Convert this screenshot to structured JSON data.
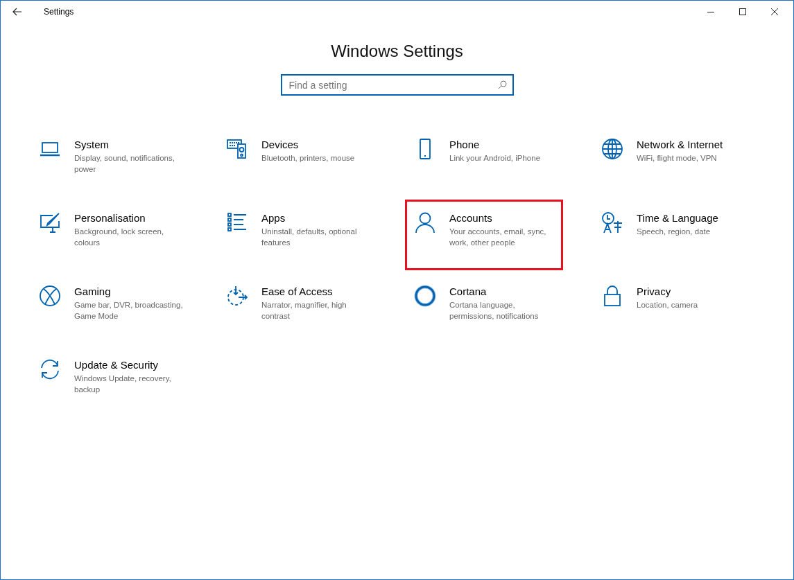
{
  "window": {
    "title": "Settings"
  },
  "heading": "Windows Settings",
  "search": {
    "placeholder": "Find a setting"
  },
  "items": [
    {
      "kind": "system",
      "title": "System",
      "subtitle": "Display, sound, notifications, power",
      "highlighted": false
    },
    {
      "kind": "devices",
      "title": "Devices",
      "subtitle": "Bluetooth, printers, mouse",
      "highlighted": false
    },
    {
      "kind": "phone",
      "title": "Phone",
      "subtitle": "Link your Android, iPhone",
      "highlighted": false
    },
    {
      "kind": "network",
      "title": "Network & Internet",
      "subtitle": "WiFi, flight mode, VPN",
      "highlighted": false
    },
    {
      "kind": "personalisation",
      "title": "Personalisation",
      "subtitle": "Background, lock screen, colours",
      "highlighted": false
    },
    {
      "kind": "apps",
      "title": "Apps",
      "subtitle": "Uninstall, defaults, optional features",
      "highlighted": false
    },
    {
      "kind": "accounts",
      "title": "Accounts",
      "subtitle": "Your accounts, email, sync, work, other people",
      "highlighted": true
    },
    {
      "kind": "time",
      "title": "Time & Language",
      "subtitle": "Speech, region, date",
      "highlighted": false
    },
    {
      "kind": "gaming",
      "title": "Gaming",
      "subtitle": "Game bar, DVR, broadcasting, Game Mode",
      "highlighted": false
    },
    {
      "kind": "ease",
      "title": "Ease of Access",
      "subtitle": "Narrator, magnifier, high contrast",
      "highlighted": false
    },
    {
      "kind": "cortana",
      "title": "Cortana",
      "subtitle": "Cortana language, permissions, notifications",
      "highlighted": false
    },
    {
      "kind": "privacy",
      "title": "Privacy",
      "subtitle": "Location, camera",
      "highlighted": false
    },
    {
      "kind": "update",
      "title": "Update & Security",
      "subtitle": "Windows Update, recovery, backup",
      "highlighted": false
    }
  ]
}
